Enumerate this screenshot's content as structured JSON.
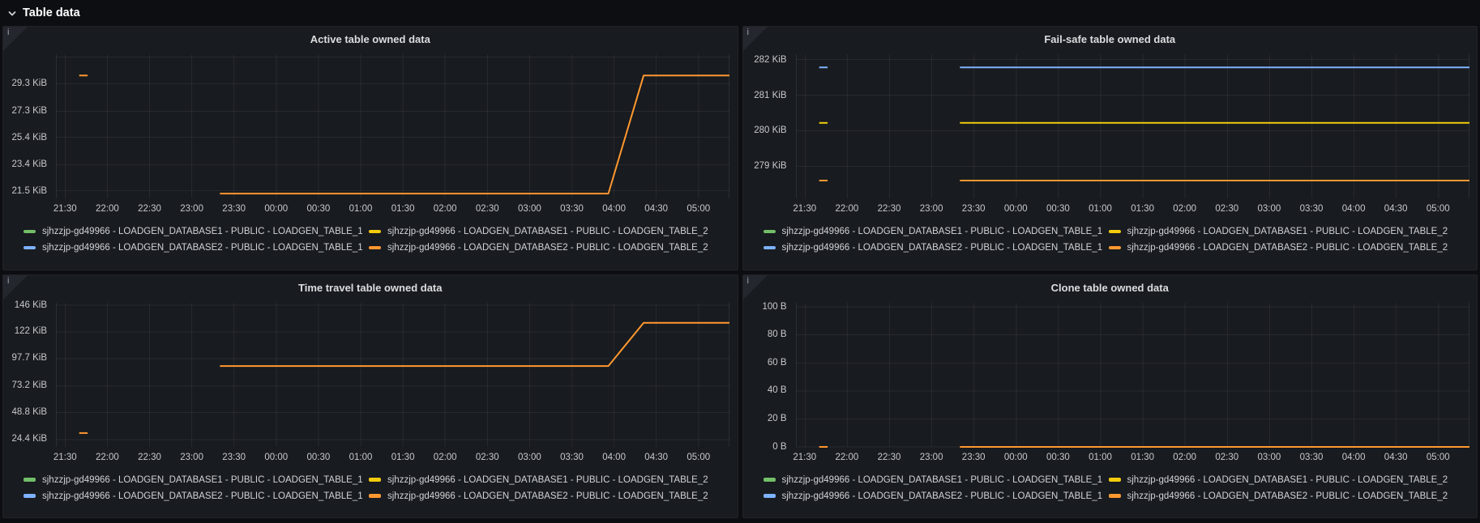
{
  "page": {
    "header": {
      "title": "Table data"
    }
  },
  "legend": [
    {
      "label": "sjhzzjp-gd49966 - LOADGEN_DATABASE1 - PUBLIC - LOADGEN_TABLE_1",
      "color": "#73BF69"
    },
    {
      "label": "sjhzzjp-gd49966 - LOADGEN_DATABASE1 - PUBLIC - LOADGEN_TABLE_2",
      "color": "#F2CC0C"
    },
    {
      "label": "sjhzzjp-gd49966 - LOADGEN_DATABASE2 - PUBLIC - LOADGEN_TABLE_1",
      "color": "#7EB2FF"
    },
    {
      "label": "sjhzzjp-gd49966 - LOADGEN_DATABASE2 - PUBLIC - LOADGEN_TABLE_2",
      "color": "#FF9830"
    }
  ],
  "x_axis": {
    "range_minutes": [
      23.5,
      502
    ],
    "ticks": [
      {
        "t": 30,
        "label": "21:30"
      },
      {
        "t": 60,
        "label": "22:00"
      },
      {
        "t": 90,
        "label": "22:30"
      },
      {
        "t": 120,
        "label": "23:00"
      },
      {
        "t": 150,
        "label": "23:30"
      },
      {
        "t": 180,
        "label": "00:00"
      },
      {
        "t": 210,
        "label": "00:30"
      },
      {
        "t": 240,
        "label": "01:00"
      },
      {
        "t": 270,
        "label": "01:30"
      },
      {
        "t": 300,
        "label": "02:00"
      },
      {
        "t": 330,
        "label": "02:30"
      },
      {
        "t": 360,
        "label": "03:00"
      },
      {
        "t": 390,
        "label": "03:30"
      },
      {
        "t": 420,
        "label": "04:00"
      },
      {
        "t": 450,
        "label": "04:30"
      },
      {
        "t": 480,
        "label": "05:00"
      }
    ]
  },
  "chart_data": [
    {
      "type": "line",
      "title": "Active table owned data",
      "y_unit": "KiB",
      "y_range": [
        20.95,
        31.45
      ],
      "y_ticks": [
        {
          "value": 31.25,
          "label": ""
        },
        {
          "value": 29.3,
          "label": "29.3 KiB"
        },
        {
          "value": 27.3,
          "label": "27.3 KiB"
        },
        {
          "value": 25.4,
          "label": "25.4 KiB"
        },
        {
          "value": 23.4,
          "label": "23.4 KiB"
        },
        {
          "value": 21.5,
          "label": "21.5 KiB"
        }
      ],
      "series": [
        {
          "legend_index": 3,
          "segments": [
            [
              [
                40,
                29.9
              ],
              [
                46,
                29.9
              ]
            ],
            [
              [
                140,
                21.3
              ],
              [
                416,
                21.3
              ],
              [
                441,
                29.9
              ],
              [
                502,
                29.9
              ]
            ]
          ]
        }
      ]
    },
    {
      "type": "line",
      "title": "Fail-safe table owned data",
      "y_unit": "KiB",
      "y_range": [
        278.1,
        282.15
      ],
      "y_ticks": [
        {
          "value": 282,
          "label": "282 KiB"
        },
        {
          "value": 281,
          "label": "281 KiB"
        },
        {
          "value": 280,
          "label": "280 KiB"
        },
        {
          "value": 279,
          "label": "279 KiB"
        }
      ],
      "series": [
        {
          "legend_index": 2,
          "segments": [
            [
              [
                40,
                281.78
              ],
              [
                46,
                281.78
              ]
            ],
            [
              [
                140,
                281.78
              ],
              [
                502,
                281.78
              ]
            ]
          ]
        },
        {
          "legend_index": 1,
          "segments": [
            [
              [
                40,
                280.22
              ],
              [
                46,
                280.22
              ]
            ],
            [
              [
                140,
                280.22
              ],
              [
                502,
                280.22
              ]
            ]
          ]
        },
        {
          "legend_index": 3,
          "segments": [
            [
              [
                40,
                278.6
              ],
              [
                46,
                278.6
              ]
            ],
            [
              [
                140,
                278.6
              ],
              [
                502,
                278.6
              ]
            ]
          ]
        }
      ]
    },
    {
      "type": "line",
      "title": "Time travel table owned data",
      "y_unit": "KiB",
      "y_range": [
        17.8,
        148.2
      ],
      "y_ticks": [
        {
          "value": 146,
          "label": "146 KiB"
        },
        {
          "value": 122,
          "label": "122 KiB"
        },
        {
          "value": 97.7,
          "label": "97.7 KiB"
        },
        {
          "value": 73.2,
          "label": "73.2 KiB"
        },
        {
          "value": 48.8,
          "label": "48.8 KiB"
        },
        {
          "value": 24.4,
          "label": "24.4 KiB"
        }
      ],
      "series": [
        {
          "legend_index": 3,
          "segments": [
            [
              [
                40,
                30.3
              ],
              [
                46,
                30.3
              ]
            ],
            [
              [
                140,
                91
              ],
              [
                416,
                91
              ],
              [
                441,
                130
              ],
              [
                502,
                130
              ]
            ]
          ]
        }
      ]
    },
    {
      "type": "line",
      "title": "Clone table owned data",
      "y_unit": "B",
      "y_range": [
        0,
        103
      ],
      "y_ticks": [
        {
          "value": 100,
          "label": "100 B"
        },
        {
          "value": 80,
          "label": "80 B"
        },
        {
          "value": 60,
          "label": "60 B"
        },
        {
          "value": 40,
          "label": "40 B"
        },
        {
          "value": 20,
          "label": "20 B"
        },
        {
          "value": 0,
          "label": "0 B"
        }
      ],
      "series": [
        {
          "legend_index": 3,
          "segments": [
            [
              [
                40,
                0
              ],
              [
                46,
                0
              ]
            ],
            [
              [
                140,
                0
              ],
              [
                502,
                0
              ]
            ]
          ]
        }
      ]
    }
  ]
}
